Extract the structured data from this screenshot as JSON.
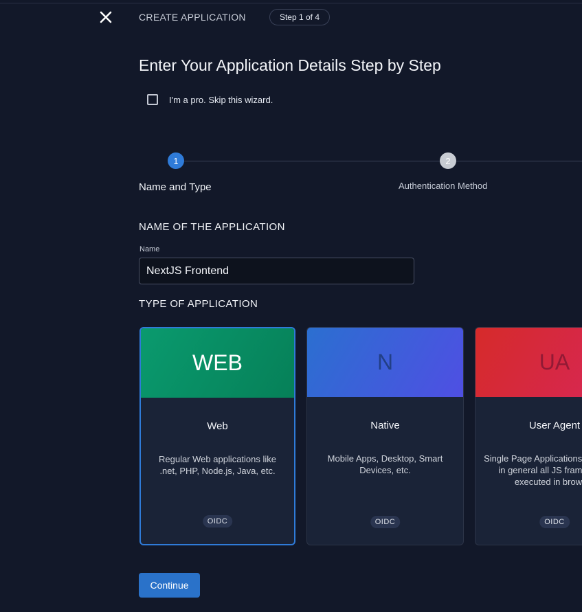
{
  "header": {
    "title": "CREATE APPLICATION",
    "step_indicator": "Step 1 of 4",
    "close_icon": "close-icon"
  },
  "main": {
    "title": "Enter Your Application Details Step by Step",
    "skip_wizard": {
      "label": "I'm a pro. Skip this wizard.",
      "checked": false
    }
  },
  "stepper": {
    "steps": [
      {
        "number": "1",
        "label": "Name and Type",
        "active": true
      },
      {
        "number": "2",
        "label": "Authentication Method",
        "active": false
      }
    ],
    "colors": {
      "active": "#2f7bd8",
      "inactive": "#c8ccd3"
    }
  },
  "name_section": {
    "title": "NAME OF THE APPLICATION",
    "field_label": "Name",
    "value": "NextJS Frontend"
  },
  "type_section": {
    "title": "TYPE OF APPLICATION",
    "cards": [
      {
        "key": "web",
        "abbr": "WEB",
        "title": "Web",
        "description": "Regular Web applications like .net, PHP, Node.js, Java, etc.",
        "badge": "OIDC",
        "selected": true
      },
      {
        "key": "native",
        "abbr": "N",
        "title": "Native",
        "description": "Mobile Apps, Desktop, Smart Devices, etc.",
        "badge": "OIDC",
        "selected": false
      },
      {
        "key": "ua",
        "abbr": "UA",
        "title": "User Agent",
        "description": "Single Page Applications (SPA) and in general all JS frameworks executed in browser",
        "badge": "OIDC",
        "selected": false
      }
    ]
  },
  "actions": {
    "continue_label": "Continue"
  },
  "colors": {
    "background": "#121829",
    "accent": "#2f7bd8",
    "card_bg": "#1a2337"
  }
}
